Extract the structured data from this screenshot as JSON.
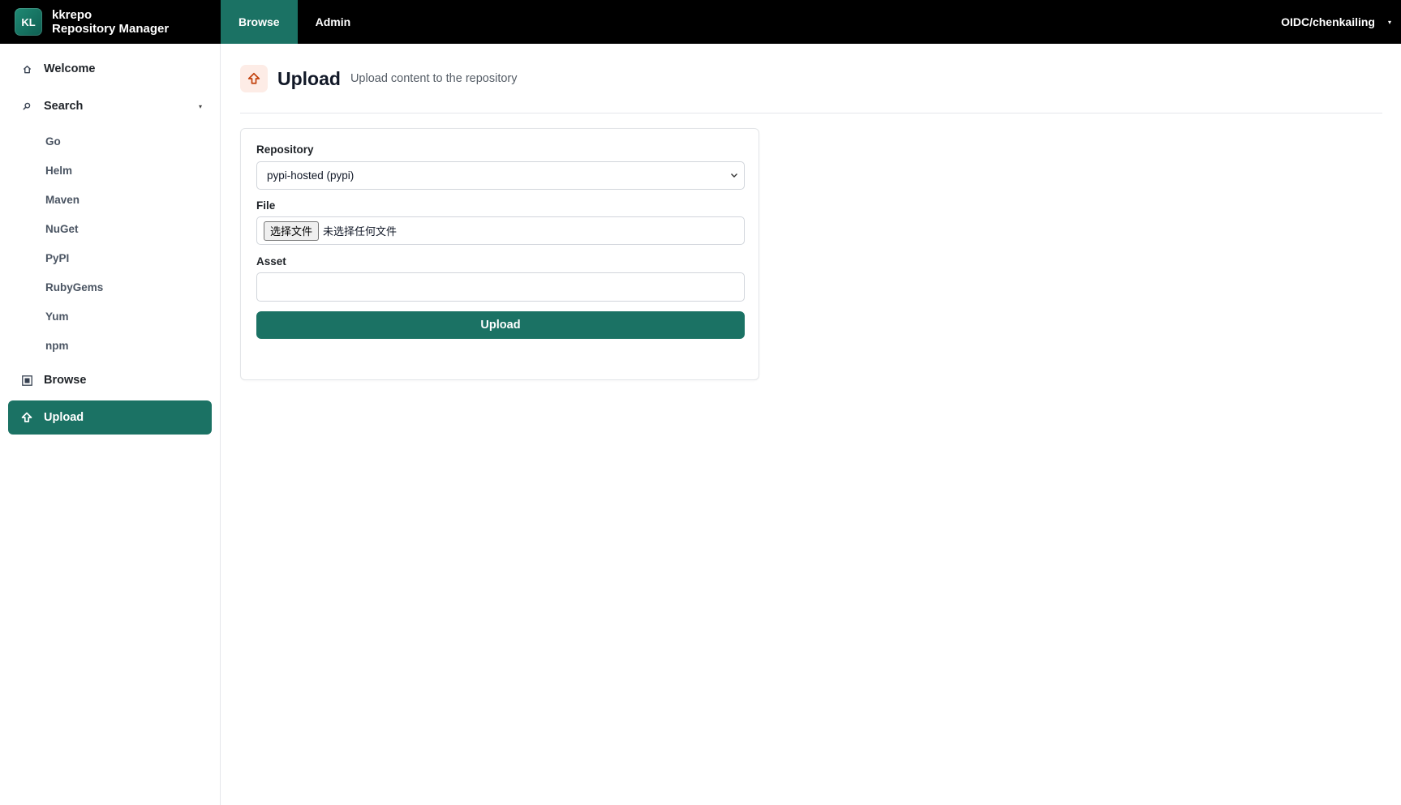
{
  "brand": {
    "logo": "KL",
    "name": "kkrepo",
    "subtitle": "Repository Manager"
  },
  "topnav": {
    "tabs": [
      {
        "label": "Browse",
        "active": true
      },
      {
        "label": "Admin",
        "active": false
      }
    ]
  },
  "user": {
    "name": "OIDC/chenkailing"
  },
  "sidebar": {
    "welcome": "Welcome",
    "search": "Search",
    "search_items": [
      "Go",
      "Helm",
      "Maven",
      "NuGet",
      "PyPI",
      "RubyGems",
      "Yum",
      "npm"
    ],
    "browse": "Browse",
    "upload": "Upload"
  },
  "page": {
    "title": "Upload",
    "subtitle": "Upload content to the repository"
  },
  "form": {
    "repository_label": "Repository",
    "repository_value": "pypi-hosted (pypi)",
    "file_label": "File",
    "file_button": "选择文件",
    "file_status": "未选择任何文件",
    "asset_label": "Asset",
    "asset_value": "",
    "submit_label": "Upload"
  },
  "colors": {
    "accent": "#1b7264",
    "topbar": "#000000",
    "upload_icon_bg": "#fdece6",
    "upload_icon": "#c2410c"
  },
  "icons": {
    "welcome": "home-icon",
    "search": "search-icon",
    "browse": "square-icon",
    "upload": "upload-arrow-icon",
    "dropdown": "chevron-down-icon",
    "caret": "caret-down-icon"
  }
}
